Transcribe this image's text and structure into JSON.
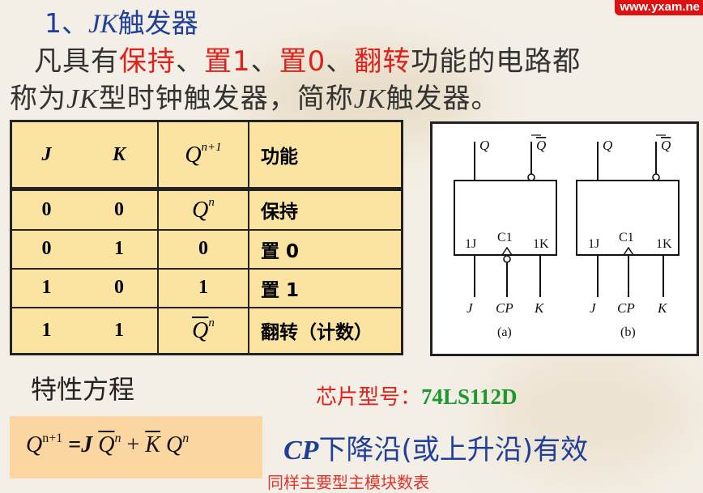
{
  "title": {
    "prefix": "1、",
    "italic": "JK",
    "suffix": "触发器"
  },
  "watermark": "www.yxam.ne",
  "intro": {
    "line1": [
      {
        "t": "凡具有",
        "red": false
      },
      {
        "t": "保持",
        "red": true
      },
      {
        "t": "、",
        "red": false
      },
      {
        "t": "置1",
        "red": true
      },
      {
        "t": "、",
        "red": false
      },
      {
        "t": "置0",
        "red": true
      },
      {
        "t": "、",
        "red": false
      },
      {
        "t": "翻转",
        "red": true
      },
      {
        "t": "功能的电路都",
        "red": false
      }
    ],
    "line2": {
      "a": "称为",
      "b": "JK",
      "c": "型时钟触发器，简称",
      "d": "JK",
      "e": "触发器。"
    }
  },
  "truth_table": {
    "headers": {
      "j": "J",
      "k": "K",
      "q": "Q",
      "q_sup": "n+1",
      "func": "功能"
    },
    "rows": [
      {
        "j": "0",
        "k": "0",
        "q": "Q",
        "q_sup": "n",
        "q_bar": false,
        "func": "保持"
      },
      {
        "j": "0",
        "k": "1",
        "q": "0",
        "q_sup": "",
        "q_bar": false,
        "func": "置 0"
      },
      {
        "j": "1",
        "k": "0",
        "q": "1",
        "q_sup": "",
        "q_bar": false,
        "func": "置 1"
      },
      {
        "j": "1",
        "k": "1",
        "q": "Q",
        "q_sup": "n",
        "q_bar": true,
        "func": "翻转（计数）"
      }
    ]
  },
  "diagram": {
    "a": {
      "q": "Q",
      "qbar": "Q",
      "in1": "1J",
      "clk": "C1",
      "in2": "1K",
      "j": "J",
      "cp": "CP",
      "k": "K",
      "caption": "(a)"
    },
    "b": {
      "q": "Q",
      "qbar": "Q",
      "in1": "1J",
      "clk": "C1",
      "in2": "1K",
      "j": "J",
      "cp": "CP",
      "k": "K",
      "caption": "(b)"
    }
  },
  "characteristic_label": "特性方程",
  "chip": {
    "label": "芯片型号：",
    "model": "74LS112D"
  },
  "equation": {
    "lhs": "Q",
    "lhs_sup": "n+1",
    "eq": "=",
    "j": "J",
    "qbar": "Q",
    "qbar_sup": "n",
    "plus": "+",
    "kbar": "K",
    "q": "Q",
    "q_sup": "n"
  },
  "cp_note": {
    "cp": "CP",
    "text": "下降沿(或上升沿)有效"
  },
  "cutoff_text": "同样主要型主模块数表"
}
